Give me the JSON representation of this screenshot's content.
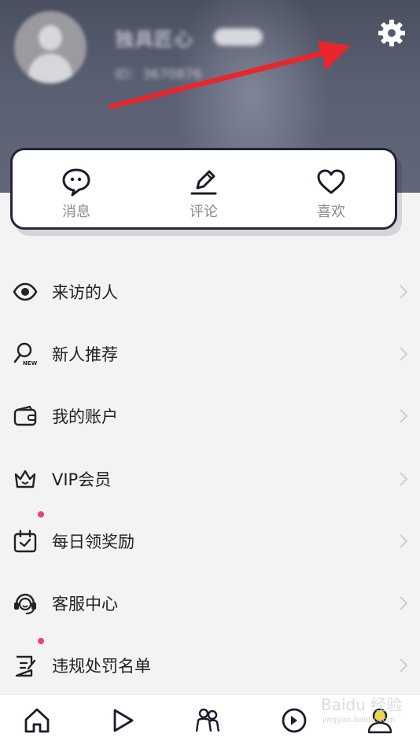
{
  "profile": {
    "username": "独具匠心",
    "user_id": "ID：3670876"
  },
  "quick_tabs": [
    {
      "label": "消息",
      "icon": "chat-bubble-icon"
    },
    {
      "label": "评论",
      "icon": "pencil-icon"
    },
    {
      "label": "喜欢",
      "icon": "heart-icon"
    }
  ],
  "menu": [
    {
      "label": "来访的人",
      "icon": "eye-icon",
      "dot": false
    },
    {
      "label": "新人推荐",
      "icon": "new-user-search-icon",
      "icon_text": "NEW",
      "dot": false
    },
    {
      "label": "我的账户",
      "icon": "wallet-icon",
      "dot": false
    },
    {
      "label": "VIP会员",
      "icon": "crown-icon",
      "dot": false
    },
    {
      "label": "每日领奖励",
      "icon": "calendar-reward-icon",
      "dot": true
    },
    {
      "label": "客服中心",
      "icon": "headset-icon",
      "dot": false
    },
    {
      "label": "违规处罚名单",
      "icon": "report-list-icon",
      "dot": true
    }
  ],
  "bottom_nav": [
    {
      "icon": "home-icon"
    },
    {
      "icon": "play-icon"
    },
    {
      "icon": "people-icon"
    },
    {
      "icon": "discover-icon"
    },
    {
      "icon": "profile-icon",
      "active": true
    }
  ],
  "watermark": {
    "text": "Baidu 经验",
    "sub": "jingyan.baidu.com"
  },
  "colors": {
    "header": "#565c6e",
    "card_border": "#25243a",
    "arrow": "#e8262c",
    "badge_dot": "#f0416a",
    "active_nav": "#f3d34a"
  }
}
